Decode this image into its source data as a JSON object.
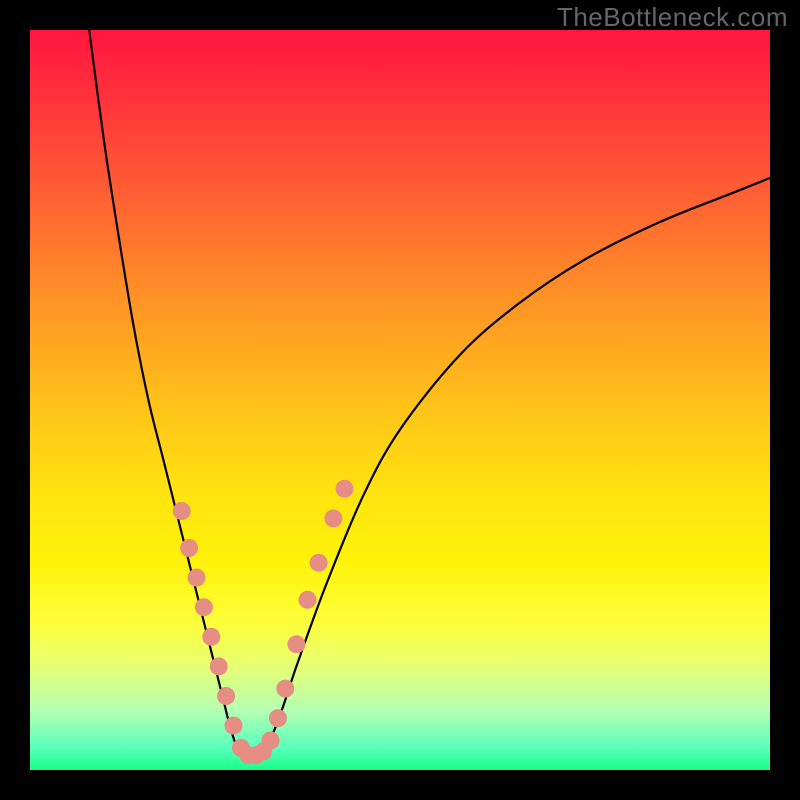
{
  "watermark": "TheBottleneck.com",
  "colors": {
    "frame_bg": "#000000",
    "dot_fill": "#e68d84",
    "curve_stroke": "#000000"
  },
  "chart_data": {
    "type": "line",
    "title": "",
    "xlabel": "",
    "ylabel": "",
    "xlim": [
      0,
      100
    ],
    "ylim": [
      0,
      100
    ],
    "series": [
      {
        "name": "left-curve",
        "x": [
          8,
          10,
          12,
          14,
          16,
          18,
          20,
          22,
          24,
          26,
          27,
          28,
          29
        ],
        "values": [
          100,
          85,
          72,
          60,
          50,
          42,
          34,
          26,
          18,
          10,
          6,
          3,
          2
        ]
      },
      {
        "name": "right-curve",
        "x": [
          31,
          32,
          34,
          36,
          40,
          45,
          50,
          58,
          66,
          75,
          85,
          95,
          100
        ],
        "values": [
          2,
          3,
          8,
          14,
          25,
          37,
          46,
          56,
          63,
          69,
          74,
          78,
          80
        ]
      }
    ],
    "points": [
      {
        "name": "left-dot-1",
        "x": 20.5,
        "y": 35
      },
      {
        "name": "left-dot-2",
        "x": 21.5,
        "y": 30
      },
      {
        "name": "left-dot-3",
        "x": 22.5,
        "y": 26
      },
      {
        "name": "left-dot-4",
        "x": 23.5,
        "y": 22
      },
      {
        "name": "left-dot-5",
        "x": 24.5,
        "y": 18
      },
      {
        "name": "left-dot-6",
        "x": 25.5,
        "y": 14
      },
      {
        "name": "left-dot-7",
        "x": 26.5,
        "y": 10
      },
      {
        "name": "left-dot-8",
        "x": 27.5,
        "y": 6
      },
      {
        "name": "valley-1",
        "x": 28.5,
        "y": 3
      },
      {
        "name": "valley-2",
        "x": 29.5,
        "y": 2
      },
      {
        "name": "valley-3",
        "x": 30.5,
        "y": 2
      },
      {
        "name": "valley-4",
        "x": 31.5,
        "y": 2.5
      },
      {
        "name": "valley-5",
        "x": 32.5,
        "y": 4
      },
      {
        "name": "right-dot-1",
        "x": 33.5,
        "y": 7
      },
      {
        "name": "right-dot-2",
        "x": 34.5,
        "y": 11
      },
      {
        "name": "right-dot-3",
        "x": 36,
        "y": 17
      },
      {
        "name": "right-dot-4",
        "x": 37.5,
        "y": 23
      },
      {
        "name": "right-dot-5",
        "x": 39,
        "y": 28
      },
      {
        "name": "right-dot-6",
        "x": 41,
        "y": 34
      },
      {
        "name": "right-dot-7",
        "x": 42.5,
        "y": 38
      }
    ]
  }
}
